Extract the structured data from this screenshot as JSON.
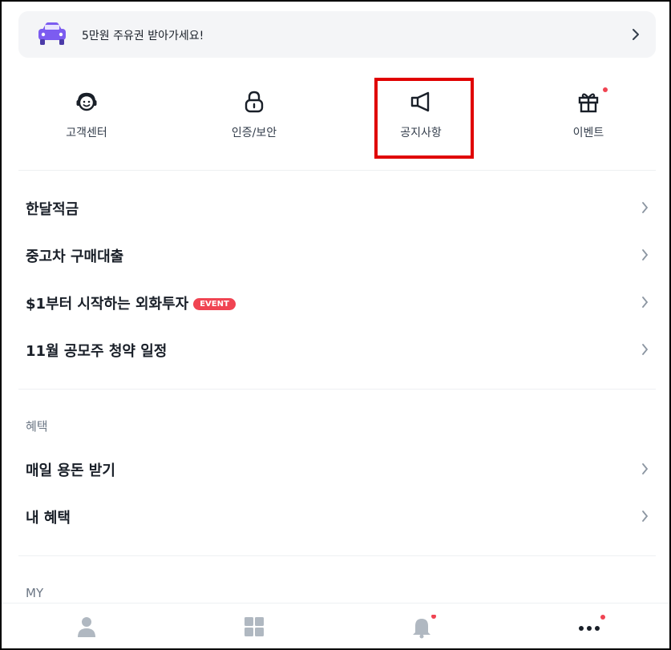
{
  "banner": {
    "text": "5만원 주유권 받아가세요!",
    "icon": "car-icon",
    "arrow": "chevron-right-icon"
  },
  "quick_menu": [
    {
      "label": "고객센터",
      "icon": "headset-icon"
    },
    {
      "label": "인증/보안",
      "icon": "lock-icon"
    },
    {
      "label": "공지사항",
      "icon": "megaphone-icon",
      "highlighted": true
    },
    {
      "label": "이벤트",
      "icon": "gift-icon",
      "has_dot": true
    }
  ],
  "menu_items": [
    {
      "label": "한달적금"
    },
    {
      "label": "중고차 구매대출"
    },
    {
      "label": "$1부터 시작하는 외화투자",
      "badge": "EVENT"
    },
    {
      "label": "11월 공모주 청약 일정"
    }
  ],
  "benefits": {
    "title": "혜택",
    "items": [
      {
        "label": "매일 용돈 받기"
      },
      {
        "label": "내 혜택"
      }
    ]
  },
  "my": {
    "title": "MY"
  },
  "bottom_nav": [
    {
      "icon": "person-icon"
    },
    {
      "icon": "grid-icon"
    },
    {
      "icon": "bell-icon",
      "has_dot": true
    },
    {
      "icon": "more-icon",
      "has_dot": true
    }
  ],
  "colors": {
    "accent_red": "#f04452",
    "highlight_box": "#e00000",
    "car_purple": "#7c5cf0"
  }
}
